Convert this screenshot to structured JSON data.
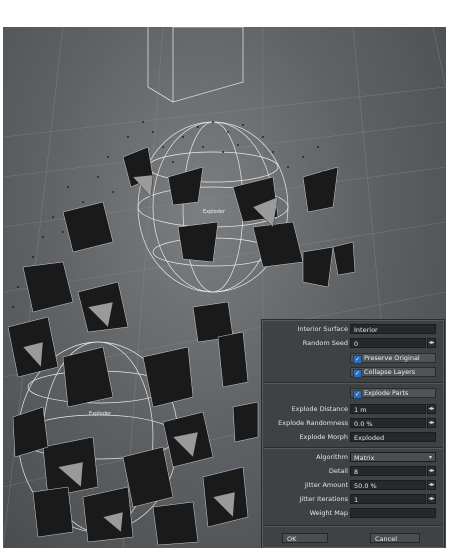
{
  "scene": {
    "object_label_1": "Exploder",
    "object_label_2": "Exploder"
  },
  "panel": {
    "interior_surface": {
      "label": "Interior Surface",
      "value": "Interior"
    },
    "random_seed": {
      "label": "Random Seed",
      "value": "0"
    },
    "preserve_original": {
      "label": "Preserve Original",
      "checked": true
    },
    "collapse_layers": {
      "label": "Collapse Layers",
      "checked": true
    },
    "explode_parts": {
      "label": "Explode Parts",
      "checked": true
    },
    "explode_distance": {
      "label": "Explode Distance",
      "value": "1 m"
    },
    "explode_randomness": {
      "label": "Explode Randomness",
      "value": "0.0 %"
    },
    "explode_morph": {
      "label": "Explode Morph",
      "value": "Exploded"
    },
    "algorithm": {
      "label": "Algorithm",
      "value": "Matrix"
    },
    "detail": {
      "label": "Detail",
      "value": "8"
    },
    "jitter_amount": {
      "label": "Jitter Amount",
      "value": "50.0 %"
    },
    "jitter_iterations": {
      "label": "Jitter Iterations",
      "value": "1"
    },
    "weight_map": {
      "label": "Weight Map",
      "value": ""
    },
    "ok_label": "OK",
    "cancel_label": "Cancel",
    "check_glyph": "✓",
    "spin_glyph": "◂▸",
    "dropdown_glyph": "▾"
  },
  "colors": {
    "viewport_bg": "#5f6366",
    "panel_bg": "#3f4245",
    "checkbox_accent": "#2f6fb3"
  }
}
